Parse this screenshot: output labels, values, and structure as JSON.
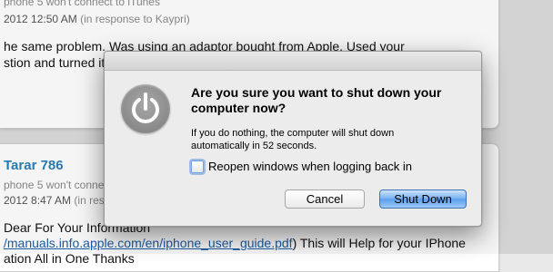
{
  "background": {
    "post1": {
      "meta_prefix": "phone 5 won't connect to iTunes",
      "date": "2012 12:50 AM",
      "reply": "(in response to Kaypri)",
      "body_line1": "he same problem.  Was using an adaptor bought from Apple.  Used your",
      "body_line2": "stion and turned it"
    },
    "post2": {
      "author": "Tarar 786",
      "meta_prefix": "phone 5 won't connect to iTunes",
      "date": "2012 8:47 AM",
      "reply": "(in response to Kaypri)",
      "body_line1": "Dear For Your Information",
      "link": "/manuals.info.apple.com/en/iphone_user_guide.pdf",
      "body_line2_suffix": ") This will Help for your IPhone",
      "body_line3": "ation All in One Thanks"
    }
  },
  "dialog": {
    "icon": "power-icon",
    "headline_line1": "Are you sure you want to shut down your",
    "headline_line2": "computer now?",
    "desc_line1": "If you do nothing, the computer will shut down",
    "desc_line2": "automatically in 52 seconds.",
    "checkbox_label": "Reopen windows when logging back in",
    "checkbox_checked": false,
    "cancel_label": "Cancel",
    "shutdown_label": "Shut Down",
    "accent_color": "#5b9deb"
  }
}
